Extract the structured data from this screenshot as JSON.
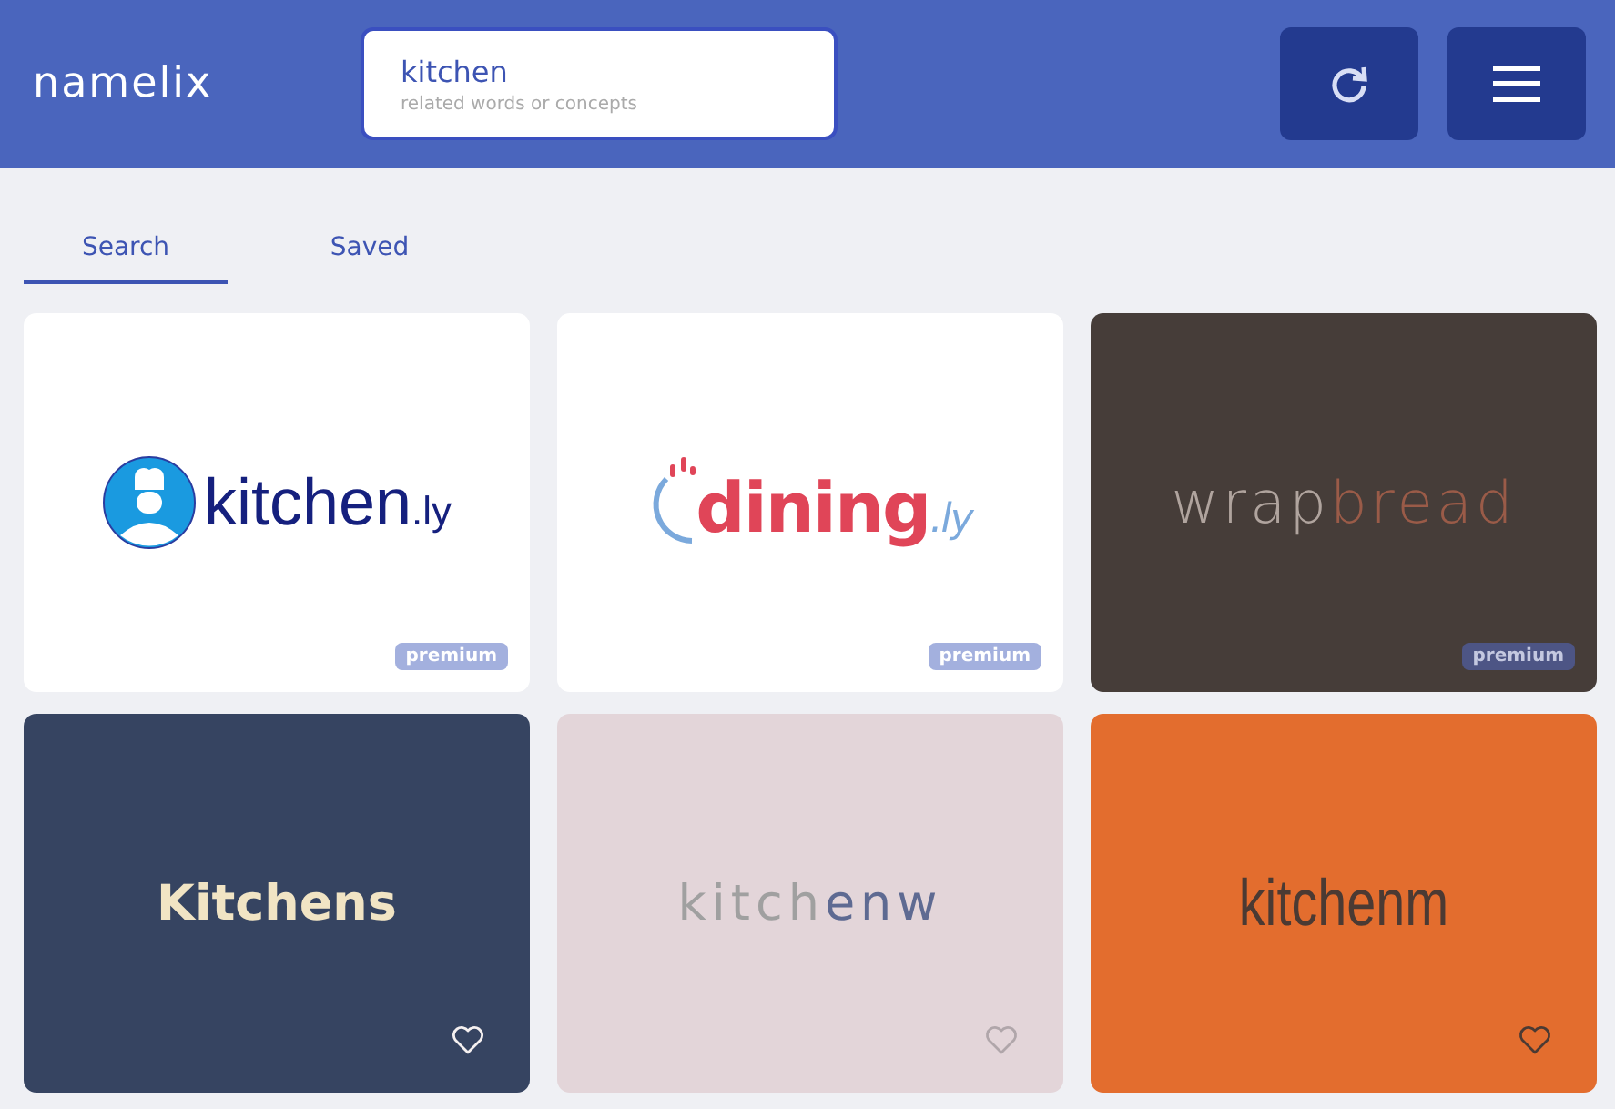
{
  "header": {
    "logo": "namelix",
    "search": {
      "value": "kitchen",
      "placeholder": "related words or concepts"
    }
  },
  "tabs": [
    {
      "label": "Search",
      "selected": true
    },
    {
      "label": "Saved",
      "selected": false
    }
  ],
  "cards": [
    {
      "kind": "chef",
      "parts": [
        "kitchen",
        ".ly"
      ],
      "badge": "premium"
    },
    {
      "kind": "dining",
      "parts": [
        "dining",
        ".ly"
      ],
      "badge": "premium"
    },
    {
      "kind": "wrap",
      "parts": [
        "wrap",
        "bread"
      ],
      "badge": "premium"
    },
    {
      "kind": "bold",
      "parts": [
        "Kitchens"
      ],
      "favorited": false
    },
    {
      "kind": "light",
      "parts": [
        "kitch",
        "enw"
      ],
      "favorited": false
    },
    {
      "kind": "condensed",
      "parts": [
        "kitchenm"
      ],
      "favorited": false
    }
  ]
}
